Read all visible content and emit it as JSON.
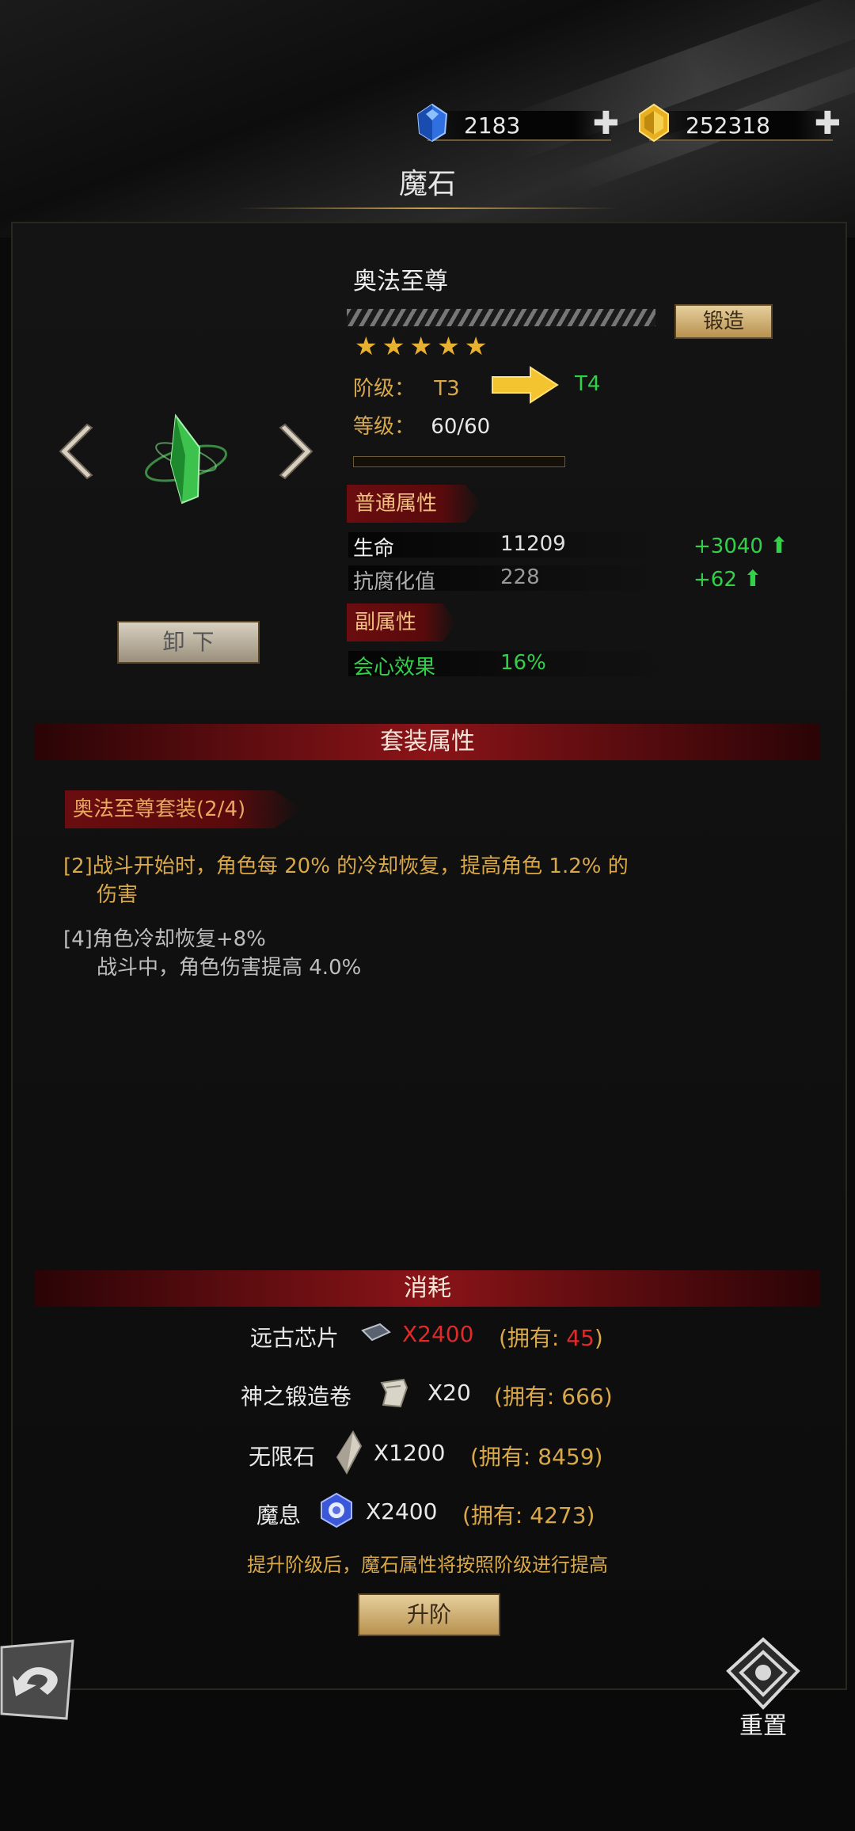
{
  "currency": {
    "diamond": "2183",
    "gold": "252318",
    "diamond_icon": "blue-crystal-icon",
    "gold_icon": "gold-gem-icon"
  },
  "header": {
    "title": "魔石"
  },
  "item": {
    "name": "奥法至尊",
    "forge_label": "锻造",
    "stars": 5,
    "tier_label": "阶级：",
    "tier_from": "T3",
    "tier_to": "T4",
    "level_label": "等级：",
    "level_value": "60/60",
    "level_progress": 0,
    "unequip_label": "卸 下",
    "prev_icon": "chevron-left-icon",
    "next_icon": "chevron-right-icon",
    "stone_icon": "green-crystal-icon"
  },
  "base_attrs": {
    "header": "普通属性",
    "rows": [
      {
        "name": "生命",
        "value": "11209",
        "delta": "+3040"
      },
      {
        "name": "抗腐化值",
        "value": "228",
        "delta": "+62"
      }
    ]
  },
  "sub_attrs": {
    "header": "副属性",
    "rows": [
      {
        "name": "会心效果",
        "value": "16%"
      }
    ]
  },
  "set": {
    "band_title": "套装属性",
    "name": "奥法至尊套装(2/4)",
    "bonus2_tag": "[2]",
    "bonus2_line1": "战斗开始时，角色每 20% 的冷却恢复，提高角色 1.2% 的",
    "bonus2_line2": "伤害",
    "bonus4_tag": "[4]",
    "bonus4_line1": "角色冷却恢复+8%",
    "bonus4_line2": "战斗中，角色伤害提高 4.0%"
  },
  "cost": {
    "band_title": "消耗",
    "items": [
      {
        "name": "远古芯片",
        "qty": "X2400",
        "own_prefix": "(拥有: ",
        "own": "45",
        "own_suffix": ")",
        "icon": "chip-icon"
      },
      {
        "name": "神之锻造卷",
        "qty": "X20",
        "own_prefix": "(拥有: ",
        "own": "666",
        "own_suffix": ")",
        "icon": "scroll-icon"
      },
      {
        "name": "无限石",
        "qty": "X1200",
        "own_prefix": "(拥有: ",
        "own": "8459",
        "own_suffix": ")",
        "icon": "infinity-stone-icon"
      },
      {
        "name": "魔息",
        "qty": "X2400",
        "own_prefix": "(拥有: ",
        "own": "4273",
        "own_suffix": ")",
        "icon": "magic-breath-icon"
      }
    ],
    "note": "提升阶级后，魔石属性将按照阶级进行提高",
    "upgrade_label": "升阶"
  },
  "footer": {
    "back_icon": "back-arrow-icon",
    "reset_label": "重置",
    "reset_icon": "reset-emblem-icon"
  },
  "colors": {
    "gold_text": "#d8a84a",
    "green_text": "#33d04a",
    "red_text": "#e02a2a",
    "band_red": "#8a1418"
  }
}
